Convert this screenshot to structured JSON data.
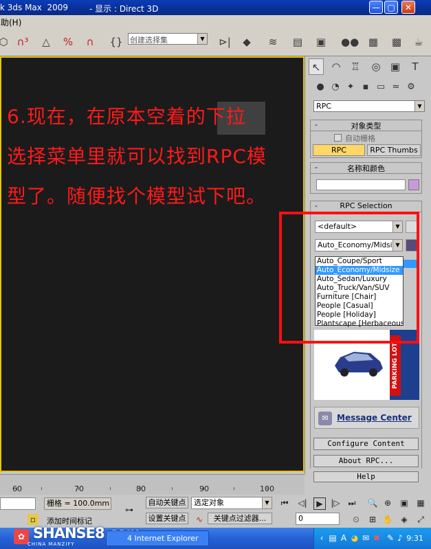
{
  "window": {
    "title_left": "k 3ds Max  2009",
    "title_right": "- 显示 : Direct 3D",
    "btn_min": "—",
    "btn_restore": "▢",
    "btn_close": "✕"
  },
  "menu": {
    "help": "助(H)"
  },
  "toolbar": {
    "selection_set_placeholder": "创建选择集",
    "icons": [
      "select-icon",
      "magnet-3-icon",
      "angle-snap-icon",
      "percent-snap-icon",
      "spinner-snap-icon",
      "named-selection-icon",
      "mirror-icon",
      "align-icon",
      "layers-icon",
      "curve-editor-icon",
      "schematic-icon",
      "material-editor-icon",
      "render-setup-icon",
      "render-frame-icon",
      "quick-render-icon"
    ]
  },
  "viewport": {
    "lines": [
      "6.现在，在原本空着的下拉",
      "选择菜单里就可以找到RPC模",
      "型了。随便找个模型试下吧。"
    ]
  },
  "command_panel": {
    "category_dropdown": "RPC",
    "object_type": {
      "title": "对象类型",
      "minus": "-",
      "auto_grid": "自动栅格",
      "btn_rpc": "RPC",
      "btn_rpc_thumbs": "RPC Thumbs"
    },
    "name_color": {
      "title": "名称和颜色",
      "minus": "-",
      "swatch_color": "#c99ad8"
    },
    "rpc_selection": {
      "title": "RPC Selection",
      "minus": "-",
      "library_dropdown": "<default>",
      "model_dropdown": "Auto_Economy/Midsize",
      "options": [
        "Auto_Coupe/Sport",
        "Auto_Economy/Midsize",
        "Auto_Sedan/Luxury",
        "Auto_Truck/Van/SUV",
        "Furniture [Chair]",
        "People [Casual]",
        "People [Holiday]",
        "Plantscape [Herbaceous]"
      ],
      "highlighted_index": 1,
      "preview_banner": "PARKING LOT"
    },
    "message_center": "Message Center",
    "configure_content": "Configure Content",
    "about_rpc": "About RPC...",
    "help": "Help"
  },
  "timeline": {
    "labels": [
      "60",
      "70",
      "80",
      "90",
      "100"
    ]
  },
  "status": {
    "grid_label": "栅格 = 100.0mm",
    "auto_key": "自动关键点",
    "set_key": "设置关键点",
    "selected_object": "选定对象",
    "key_filters": "关键点过滤器...",
    "add_time_tag": "添加时间标记",
    "frame_value": "0"
  },
  "taskbar": {
    "logo_text": "SHANSE8.com",
    "logo_sub": "CHINA MANZIFY",
    "ie_task": "4 Internet Explorer",
    "clock": "9:31"
  }
}
